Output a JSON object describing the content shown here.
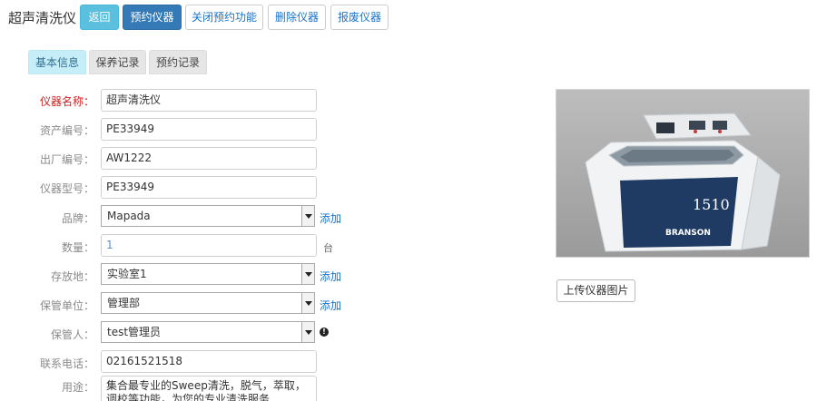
{
  "page": {
    "title": "超声清洗仪"
  },
  "toolbar": {
    "back": "返回",
    "book": "预约仪器",
    "close_booking": "关闭预约功能",
    "delete": "删除仪器",
    "scrap": "报废仪器"
  },
  "tabs": [
    {
      "label": "基本信息",
      "active": true
    },
    {
      "label": "保养记录",
      "active": false
    },
    {
      "label": "预约记录",
      "active": false
    }
  ],
  "form": {
    "name": {
      "label": "仪器名称：",
      "value": "超声清洗仪"
    },
    "asset_no": {
      "label": "资产编号：",
      "value": "PE33949"
    },
    "serial_no": {
      "label": "出厂编号：",
      "value": "AW1222"
    },
    "model": {
      "label": "仪器型号：",
      "value": "PE33949"
    },
    "brand": {
      "label": "品牌：",
      "value": "Mapada",
      "add": "添加"
    },
    "quantity": {
      "label": "数量：",
      "value": "1",
      "unit": "台"
    },
    "location": {
      "label": "存放地：",
      "value": "实验室1",
      "add": "添加"
    },
    "department": {
      "label": "保管单位：",
      "value": "管理部",
      "add": "添加"
    },
    "keeper": {
      "label": "保管人：",
      "value": "test管理员"
    },
    "phone": {
      "label": "联系电话：",
      "value": "02161521518"
    },
    "usage": {
      "label": "用途：",
      "value": "集合最专业的Sweep清洗，脱气，萃取，调校等功能，为您的专业清洗服务"
    }
  },
  "photo": {
    "upload": "上传仪器图片",
    "model_text": "1510",
    "brand_text": "BRANSON"
  },
  "colors": {
    "info": "#5bc0de",
    "primary": "#337ab7",
    "link": "#1a73c8",
    "required": "#cc1f1f"
  }
}
